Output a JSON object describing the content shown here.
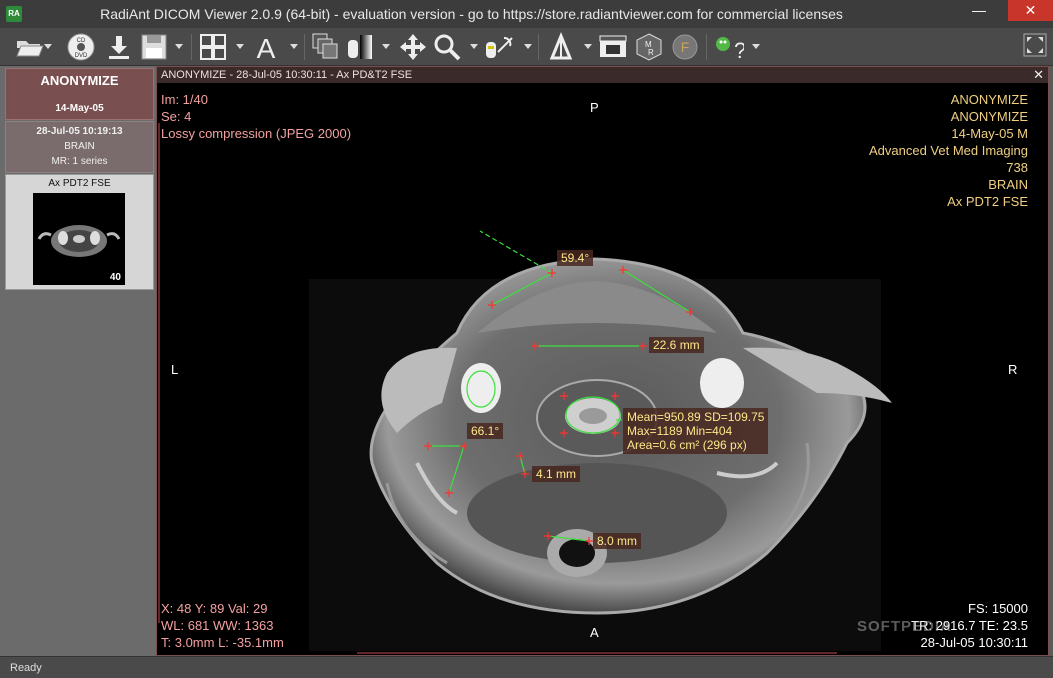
{
  "window": {
    "title": "RadiAnt DICOM Viewer 2.0.9 (64-bit) - evaluation version - go to https://store.radiantviewer.com for commercial licenses",
    "app_icon": "RA"
  },
  "toolbar": {
    "icons": [
      "open-folder-icon",
      "cd-dvd-icon",
      "download-icon",
      "save-icon",
      "layout-grid-icon",
      "annotation-text-icon",
      "series-stack-icon",
      "window-level-icon",
      "pan-icon",
      "zoom-icon",
      "measure-tools-icon",
      "mpr-icon",
      "movie-icon",
      "3d-mpr-icon",
      "fusion-icon",
      "help-icon",
      "fullscreen-icon"
    ]
  },
  "left_panel": {
    "patient": {
      "name": "ANONYMIZE",
      "date": "14-May-05"
    },
    "study": {
      "datetime": "28-Jul-05 10:19:13",
      "description": "BRAIN",
      "modality_info": "MR: 1 series"
    },
    "series": {
      "name": "Ax PDT2 FSE",
      "count": "40"
    }
  },
  "viewport": {
    "header": "ANONYMIZE - 28-Jul-05 10:30:11 - Ax PD&T2 FSE",
    "overlay_top_left": [
      "Im: 1/40",
      "Se: 4",
      "Lossy compression (JPEG 2000)"
    ],
    "overlay_top_right": [
      "ANONYMIZE",
      "ANONYMIZE",
      "14-May-05 M",
      "Advanced Vet Med Imaging",
      "738",
      "BRAIN",
      "Ax PDT2 FSE"
    ],
    "overlay_bottom_left": [
      "X: 48 Y: 89 Val: 29",
      "WL: 681 WW: 1363",
      "T: 3.0mm L: -35.1mm"
    ],
    "overlay_bottom_right": [
      "FS: 15000",
      "TR: 2916.7 TE: 23.5",
      "28-Jul-05 10:30:11"
    ],
    "orientation": {
      "top": "P",
      "bottom": "A",
      "left": "L",
      "right": "R"
    },
    "measurements": {
      "angle1": "59.4°",
      "distance1": "22.6 mm",
      "roi_mean": "Mean=950.89 SD=109.75",
      "roi_max": "Max=1189 Min=404",
      "roi_area": "Area=0.6 cm² (296 px)",
      "angle2": "66.1°",
      "distance2": "4.1 mm",
      "distance3": "8.0 mm"
    },
    "watermark": "SOFTPEDIA"
  },
  "status": {
    "text": "Ready"
  },
  "colors": {
    "accent": "#7a4f50",
    "overlay_text": "#f0d080",
    "measure_line": "#3ce03c",
    "marker": "#ff3030"
  }
}
